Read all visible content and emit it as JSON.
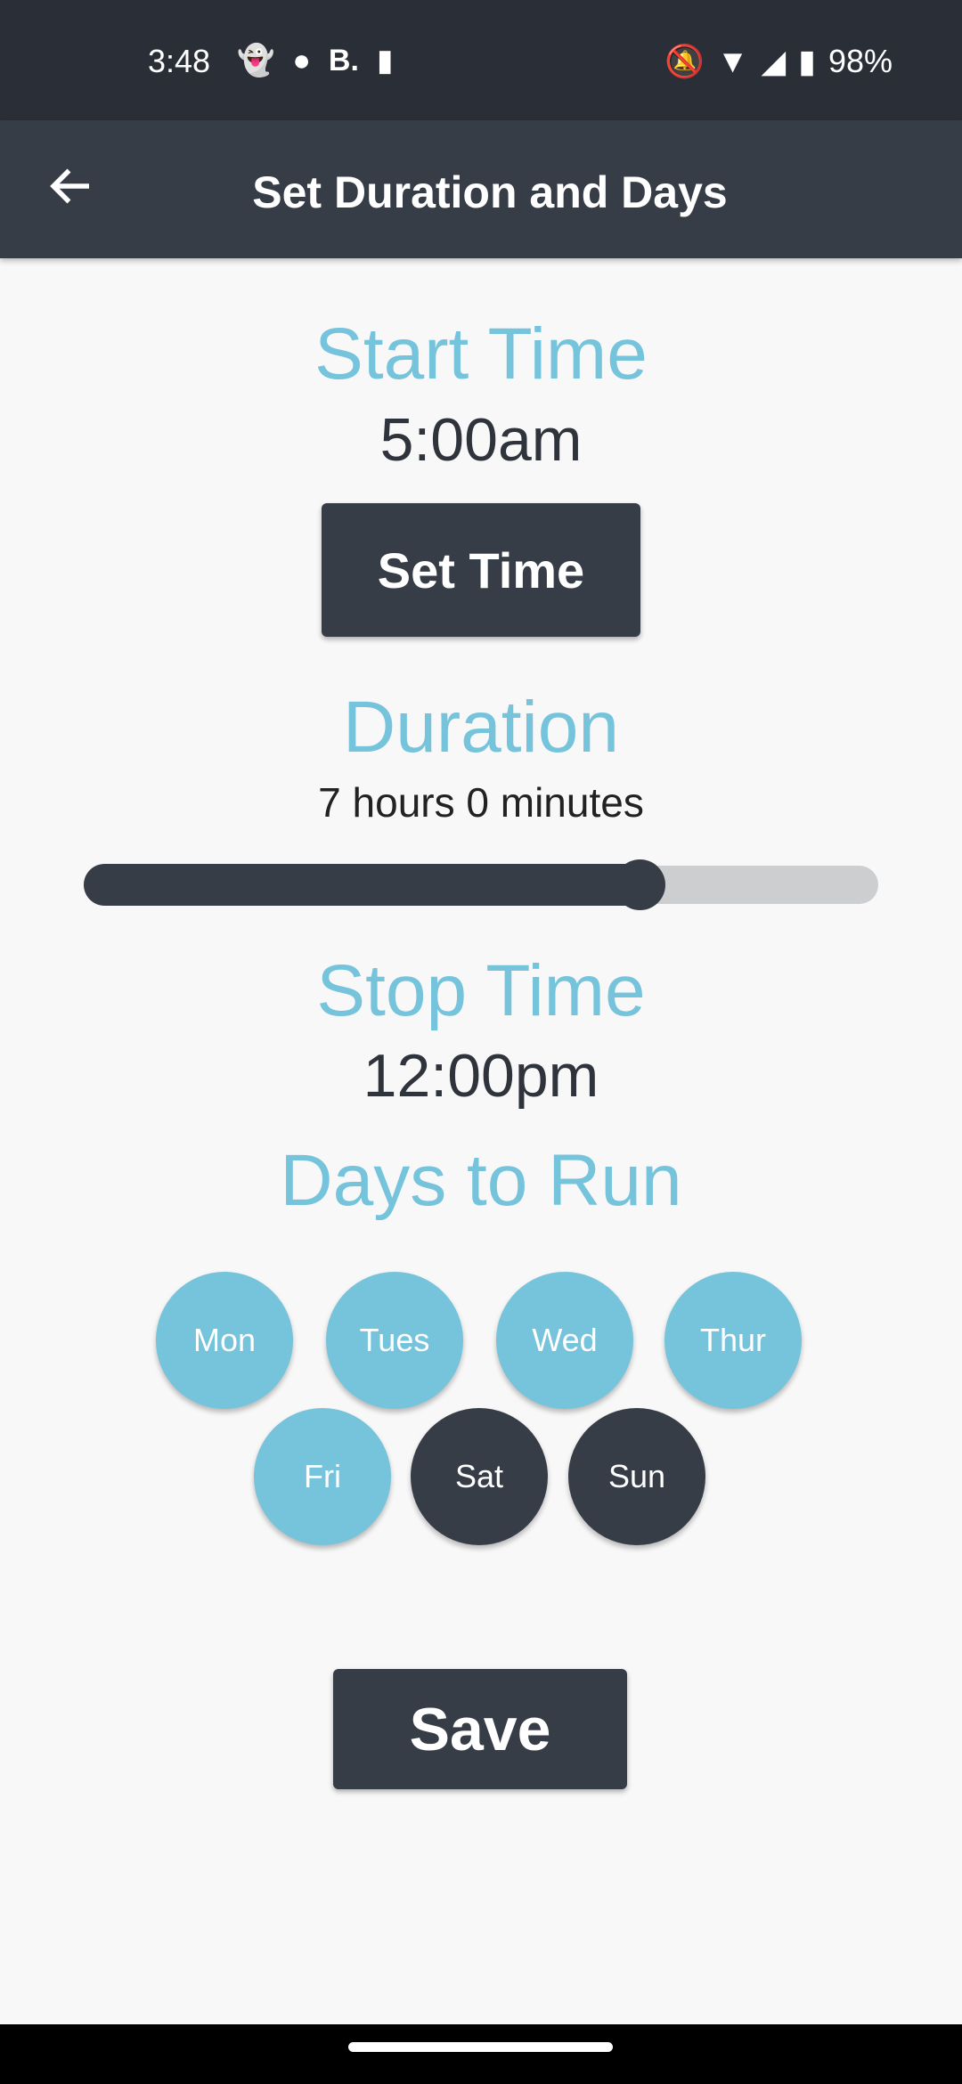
{
  "status_bar": {
    "time": "3:48",
    "battery": "98%",
    "left_icons": [
      "snapchat-icon",
      "messenger-icon",
      "b-icon",
      "download-icon"
    ],
    "right_icons": [
      "bell-off-icon",
      "wifi-icon",
      "signal-icon",
      "battery-charging-icon"
    ]
  },
  "app_bar": {
    "title": "Set Duration and Days",
    "back_icon": "arrow-left-icon"
  },
  "start": {
    "heading": "Start Time",
    "value": "5:00am",
    "button": "Set Time"
  },
  "duration": {
    "heading": "Duration",
    "value": "7 hours 0 minutes",
    "slider_fraction": 0.7
  },
  "stop": {
    "heading": "Stop Time",
    "value": "12:00pm"
  },
  "days": {
    "heading": "Days to Run",
    "items": [
      {
        "label": "Mon",
        "selected": true
      },
      {
        "label": "Tues",
        "selected": true
      },
      {
        "label": "Wed",
        "selected": true
      },
      {
        "label": "Thur",
        "selected": true
      },
      {
        "label": "Fri",
        "selected": true
      },
      {
        "label": "Sat",
        "selected": false
      },
      {
        "label": "Sun",
        "selected": false
      }
    ]
  },
  "save_label": "Save",
  "colors": {
    "accent": "#76c3dc",
    "dark": "#373d47",
    "background": "#f8f8f8"
  }
}
